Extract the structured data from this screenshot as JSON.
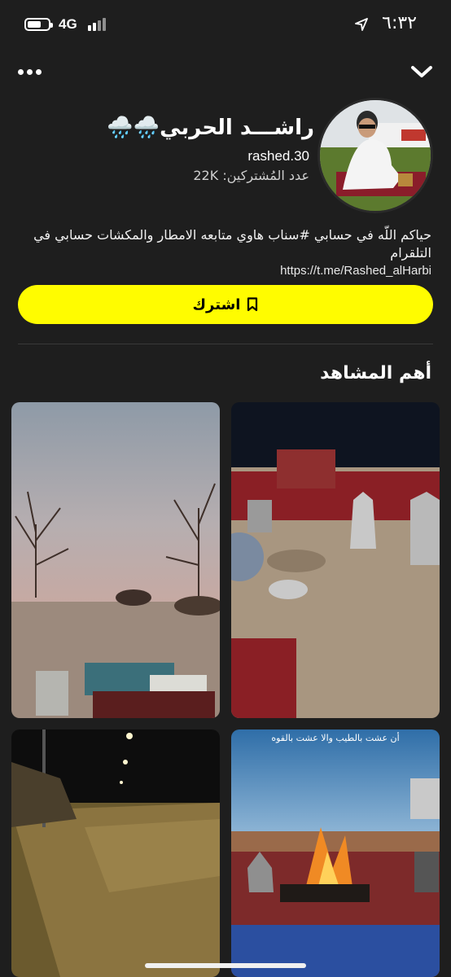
{
  "status_bar": {
    "time": "٦:٣٢",
    "network": "4G"
  },
  "profile": {
    "name": "راشـــد الحربي🌧️🌧️",
    "username": "rashed.30",
    "subscribers": "عدد المُشتركين: 22K",
    "bio": "حياكم اللّه في حسابي #سناب هاوي متابعه الامطار والمكشات حسابي في التلقرام",
    "bio_link": "https://t.me/Rashed_alHarbi"
  },
  "actions": {
    "subscribe_label": "اشترك"
  },
  "highlights": {
    "title": "أهم المشاهد",
    "tiles": [
      {
        "caption": ""
      },
      {
        "caption": ""
      },
      {
        "caption": ""
      },
      {
        "caption": "أن عشت بالطيب والا عشت بالقوه"
      }
    ]
  },
  "icons": {
    "more": "more-icon",
    "chevron": "chevron-down-icon",
    "bookmark": "bookmark-icon",
    "location": "location-arrow-icon"
  },
  "colors": {
    "background": "#1e1e1e",
    "accent": "#fffc00"
  }
}
